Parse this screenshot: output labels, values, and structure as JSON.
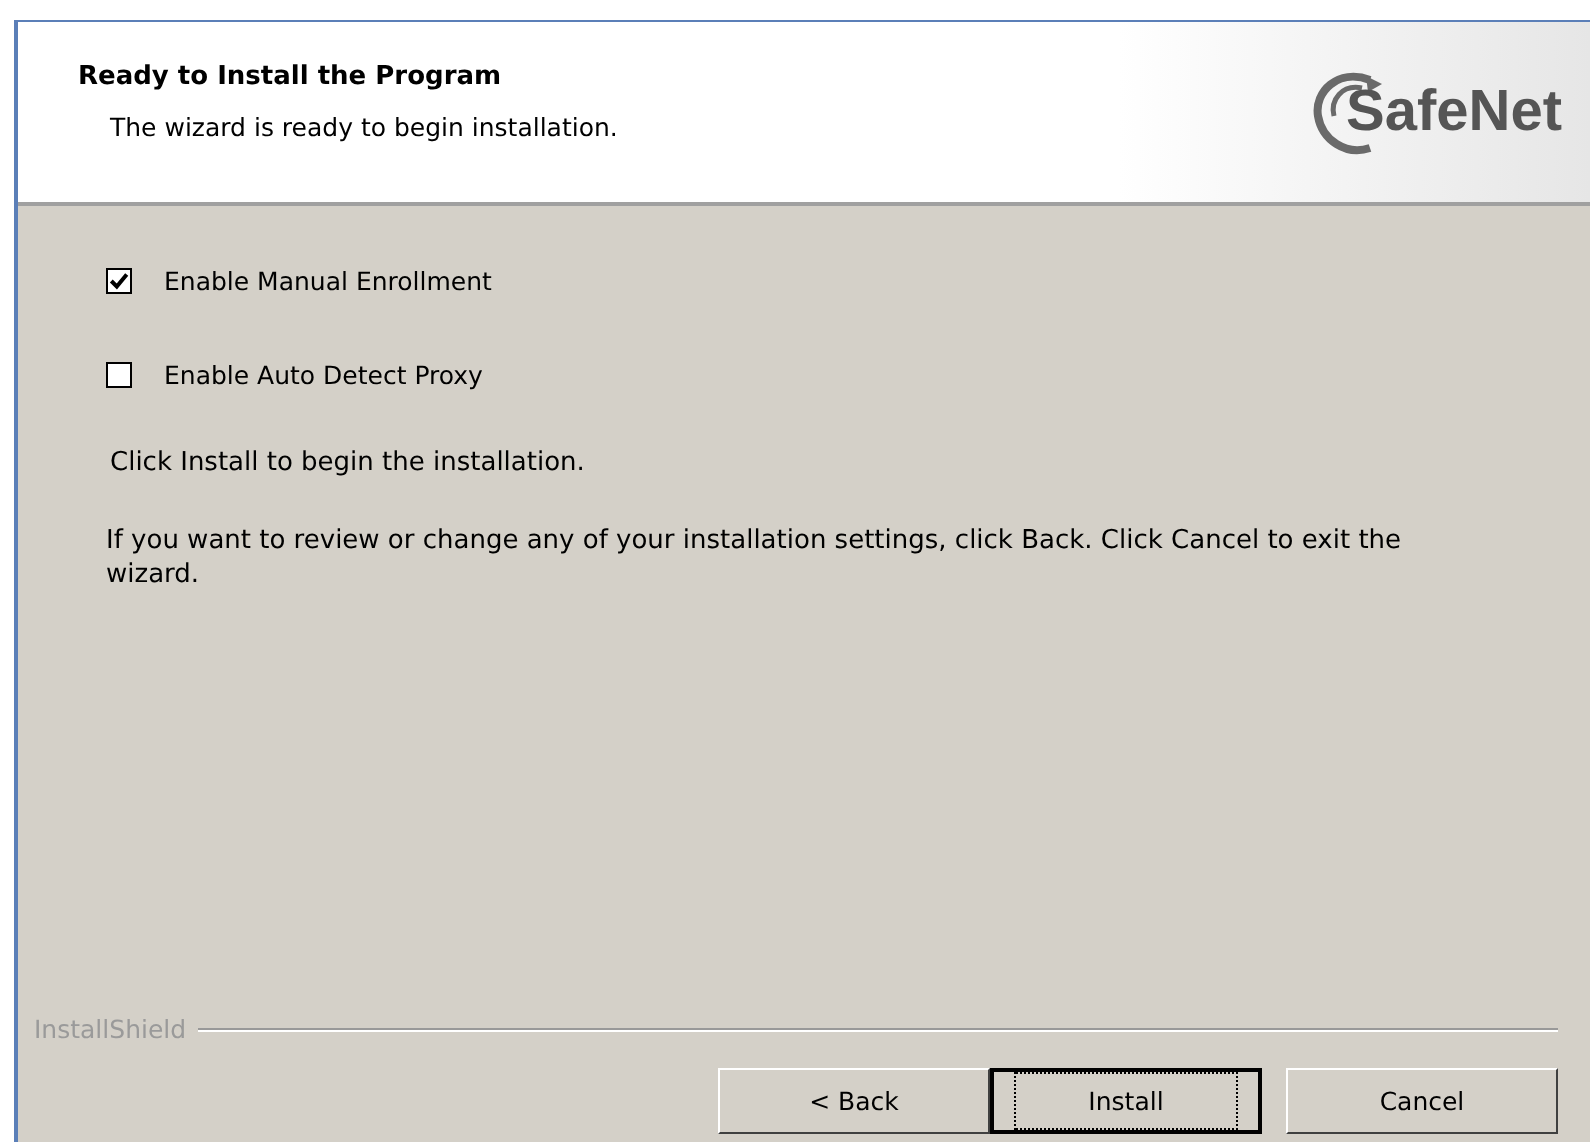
{
  "header": {
    "title": "Ready to Install the Program",
    "subtitle": "The wizard is ready to begin installation.",
    "logo": "SafeNet"
  },
  "options": [
    {
      "label": "Enable Manual Enrollment",
      "checked": true
    },
    {
      "label": "Enable Auto Detect Proxy",
      "checked": false
    }
  ],
  "messages": [
    "Click Install to begin the installation.",
    "If you want to review or change any of your installation settings, click Back. Click Cancel to exit the wizard."
  ],
  "footer": {
    "brand": "InstallShield"
  },
  "buttons": [
    {
      "label": "< Back",
      "default": false
    },
    {
      "label": "Install",
      "default": true
    },
    {
      "label": "Cancel",
      "default": false
    }
  ]
}
